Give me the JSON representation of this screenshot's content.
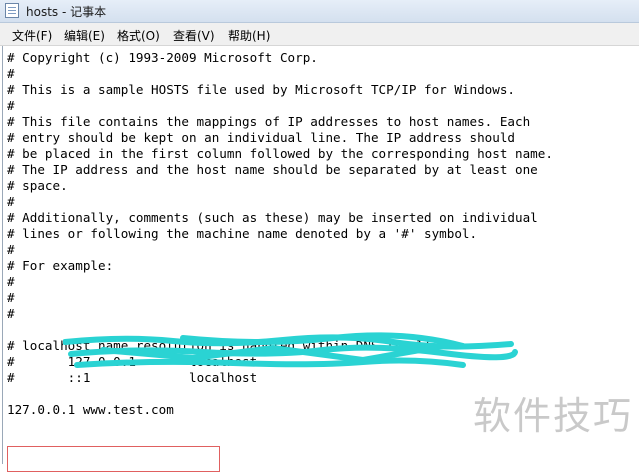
{
  "window": {
    "title": "hosts - 记事本"
  },
  "menu": [
    {
      "label": "文件(F)"
    },
    {
      "label": "编辑(E)"
    },
    {
      "label": "格式(O)"
    },
    {
      "label": "查看(V)"
    },
    {
      "label": "帮助(H)"
    }
  ],
  "editor": {
    "lines": [
      "# Copyright (c) 1993-2009 Microsoft Corp.",
      "#",
      "# This is a sample HOSTS file used by Microsoft TCP/IP for Windows.",
      "#",
      "# This file contains the mappings of IP addresses to host names. Each",
      "# entry should be kept on an individual line. The IP address should",
      "# be placed in the first column followed by the corresponding host name.",
      "# The IP address and the host name should be separated by at least one",
      "# space.",
      "#",
      "# Additionally, comments (such as these) may be inserted on individual",
      "# lines or following the machine name denoted by a '#' symbol.",
      "#",
      "# For example:",
      "#",
      "#",
      "#",
      "",
      "# localhost name resolution is handled within DNS itself.",
      "#\t127.0.0.1       localhost",
      "#\t::1             localhost",
      "",
      "127.0.0.1 www.test.com"
    ]
  },
  "scribble": {
    "color": "#2ad3d3",
    "icon": "redaction-scribble"
  },
  "highlight": {
    "color": "#e06060"
  },
  "watermark": {
    "text": "软件技巧"
  }
}
